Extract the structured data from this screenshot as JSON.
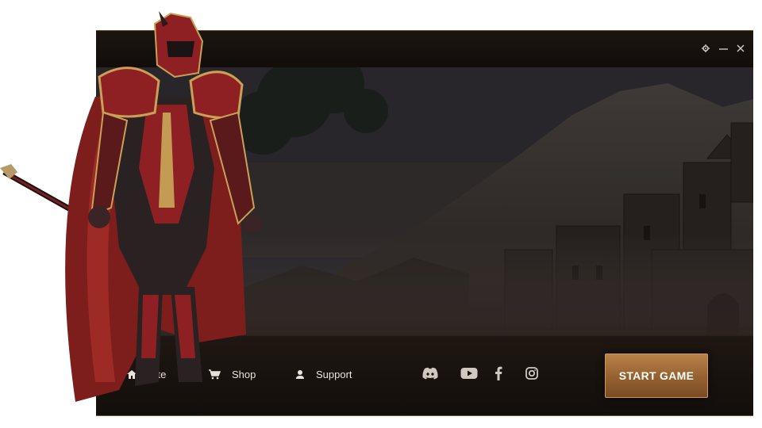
{
  "window": {
    "controls": [
      "settings",
      "minimize",
      "close"
    ]
  },
  "nav": {
    "site_label": "Site",
    "shop_label": "Shop",
    "support_label": "Support"
  },
  "social": [
    "discord",
    "youtube",
    "facebook",
    "instagram"
  ],
  "start_button_label": "START GAME",
  "colors": {
    "accent": "#9c6934",
    "frame_border": "#6b5234",
    "background": "#16100c",
    "text": "#e8e2da"
  }
}
